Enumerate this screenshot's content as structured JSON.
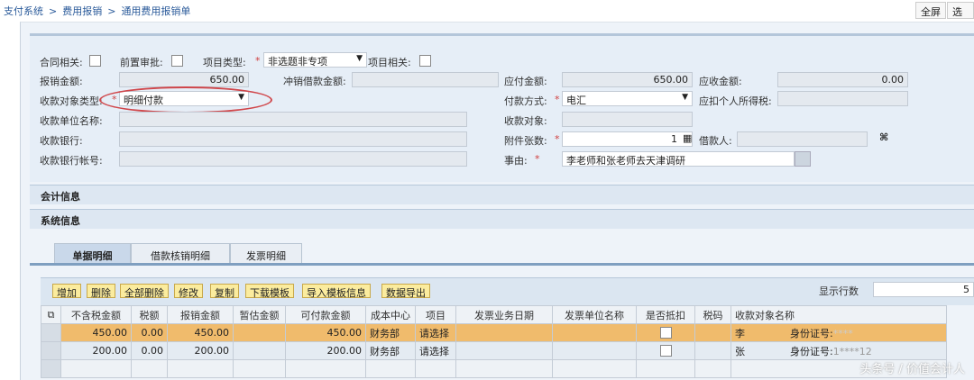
{
  "breadcrumb": [
    "支付系统",
    ">",
    "费用报销",
    ">",
    "通用费用报销单"
  ],
  "top_buttons": {
    "fullscreen": "全屏",
    "options": "选项"
  },
  "form": {
    "contract_related": "合同相关:",
    "pre_approval": "前置审批:",
    "project_type_label": "项目类型:",
    "project_type_value": "非选题非专项",
    "project_related": "项目相关:",
    "reimburse_amount_label": "报销金额:",
    "reimburse_amount": "650.00",
    "offset_loan_label": "冲销借款金额:",
    "offset_loan": "",
    "payable_label": "应付金额:",
    "payable": "650.00",
    "receivable_label": "应收金额:",
    "receivable": "0.00",
    "payee_type_label": "收款对象类型:",
    "payee_type_value": "明细付款",
    "payment_method_label": "付款方式:",
    "payment_method_value": "电汇",
    "income_tax_label": "应扣个人所得税:",
    "payee_unit_label": "收款单位名称:",
    "payee_label": "收款对象:",
    "bank_label": "收款银行:",
    "attachments_label": "附件张数:",
    "attachments": "1",
    "borrower_label": "借款人:",
    "bank_account_label": "收款银行帐号:",
    "reason_label": "事由:",
    "reason": "李老师和张老师去天津调研",
    "required_mark": "*"
  },
  "sections": [
    "会计信息",
    "系统信息"
  ],
  "tabs": [
    "单据明细",
    "借款核销明细",
    "发票明细"
  ],
  "toolbar": [
    "增加",
    "删除",
    "全部删除",
    "修改",
    "复制",
    "下载模板",
    "导入模板信息",
    "数据导出"
  ],
  "rows_label": "显示行数",
  "rows_value": "5",
  "table": {
    "headers": [
      "不含税金额",
      "税额",
      "报销金额",
      "暂估金额",
      "可付款金额",
      "成本中心",
      "项目",
      "发票业务日期",
      "发票单位名称",
      "是否抵扣",
      "税码",
      "收款对象名称"
    ],
    "rows": [
      {
        "net": "450.00",
        "tax": "0.00",
        "amount": "450.00",
        "est": "",
        "payable": "450.00",
        "cost_center": "财务部",
        "project": "请选择",
        "payee": "李",
        "id_label": "身份证号:",
        "id": "**** "
      },
      {
        "net": "200.00",
        "tax": "0.00",
        "amount": "200.00",
        "est": "",
        "payable": "200.00",
        "cost_center": "财务部",
        "project": "请选择",
        "payee": "张",
        "id_label": "身份证号:",
        "id": "1****12"
      }
    ]
  },
  "watermark": "头条号 / 价值会计人"
}
